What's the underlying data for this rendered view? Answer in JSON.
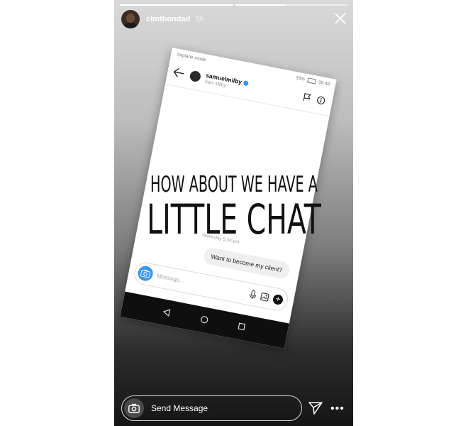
{
  "story": {
    "username": "clintbondad",
    "time": "5h",
    "progress": [
      1.0,
      0.45
    ]
  },
  "phone": {
    "statusbar_left": "Airplane mode",
    "statusbar_battery": "33%",
    "statusbar_time": "05:48",
    "dm_username": "samuelmilby",
    "dm_fullname": "Sam Milby",
    "timestamp": "Yesterday 5:34 pm",
    "message": "Want to become my client?",
    "composer_placeholder": "Message..."
  },
  "overlay": {
    "line1": "HOW ABOUT WE HAVE A",
    "line2": "LITTLE CHAT"
  },
  "footer": {
    "send_message": "Send Message"
  },
  "colors": {
    "accent": "#3897f0",
    "text_dark": "#111111"
  }
}
